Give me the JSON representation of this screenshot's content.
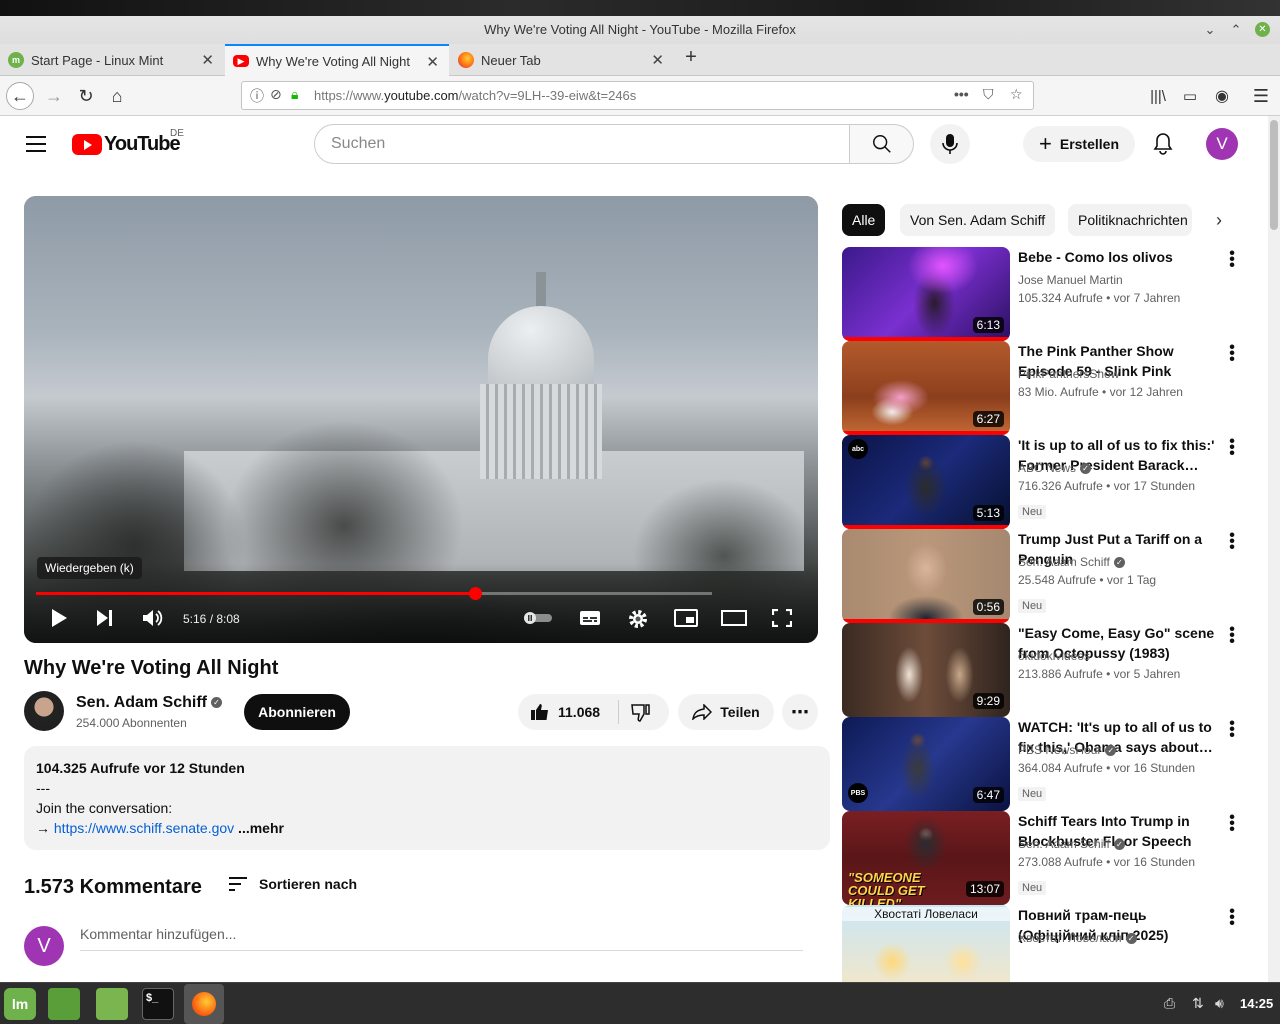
{
  "window": {
    "title": "Why We're Voting All Night - YouTube - Mozilla Firefox"
  },
  "tabs": [
    {
      "label": "Start Page - Linux Mint",
      "active": false
    },
    {
      "label": "Why We're Voting All Night",
      "active": true
    },
    {
      "label": "Neuer Tab",
      "active": false
    }
  ],
  "url": {
    "prefix": "https://www.",
    "domain": "youtube.com",
    "path": "/watch?v=9LH--39-eiw&t=246s"
  },
  "yt": {
    "logo": "YouTube",
    "country": "DE",
    "search_placeholder": "Suchen",
    "create_label": "Erstellen",
    "avatar_letter": "V"
  },
  "player": {
    "tooltip": "Wiedergeben (k)",
    "time": "5:16 / 8:08",
    "progress": 0.65
  },
  "video": {
    "title": "Why We're Voting All Night",
    "channel": "Sen. Adam Schiff",
    "subscribers": "254.000 Abonnenten",
    "subscribe_label": "Abonnieren",
    "likes": "11.068",
    "share_label": "Teilen",
    "description": {
      "stats": "104.325 Aufrufe  vor 12 Stunden",
      "line1": "---",
      "line2": "Join the conversation:",
      "arrow": "→ ",
      "link": "https://www.schiff.senate.gov",
      "more": " ...mehr"
    }
  },
  "comments": {
    "count": "1.573 Kommentare",
    "sort_label": "Sortieren nach",
    "avatar_letter": "V",
    "placeholder": "Kommentar hinzufügen..."
  },
  "chips": [
    "Alle",
    "Von Sen. Adam Schiff",
    "Politiknachrichten"
  ],
  "recommendations": [
    {
      "title": "Bebe - Como los olivos",
      "channel": "Jose Manuel Martin",
      "verified": false,
      "meta": "105.324 Aufrufe • vor 7 Jahren",
      "duration": "6:13",
      "new": "",
      "progress": 1,
      "thumb": "concert"
    },
    {
      "title": "The Pink Panther Show Episode 59 - Slink Pink",
      "channel": "PinkPanthersShow",
      "verified": false,
      "meta": "83 Mio. Aufrufe • vor 12 Jahren",
      "duration": "6:27",
      "new": "",
      "progress": 1,
      "thumb": "cartoon"
    },
    {
      "title": "'It is up to all of us to fix this:' Former President Barack…",
      "channel": "ABC News",
      "verified": true,
      "meta": "716.326 Aufrufe • vor 17 Stunden",
      "duration": "5:13",
      "new": "Neu",
      "progress": 1,
      "thumb": "stage"
    },
    {
      "title": "Trump Just Put a Tariff on a Penguin",
      "channel": "Sen. Adam Schiff",
      "verified": true,
      "meta": "25.548 Aufrufe • vor 1 Tag",
      "duration": "0:56",
      "new": "Neu",
      "progress": 1,
      "thumb": "portrait"
    },
    {
      "title": "\"Easy Come, Easy Go\" scene from Octopussy (1983)",
      "channel": "okidokivideos",
      "verified": false,
      "meta": "213.886 Aufrufe • vor 5 Jahren",
      "duration": "9:29",
      "new": "",
      "progress": 0,
      "thumb": "movie"
    },
    {
      "title": "WATCH: 'It's up to all of us to fix this,' Obama says about…",
      "channel": "PBS NewsHour",
      "verified": true,
      "meta": "364.084 Aufrufe • vor 16 Stunden",
      "duration": "6:47",
      "new": "Neu",
      "progress": 0,
      "thumb": "stage2"
    },
    {
      "title": "Schiff Tears Into Trump in Blockbuster Floor Speech",
      "channel": "Sen. Adam Schiff",
      "verified": true,
      "meta": "273.088 Aufrufe • vor 16 Stunden",
      "duration": "13:07",
      "new": "Neu",
      "progress": 0,
      "thumb": "senate",
      "caption": "\"SOMEONE COULD GET KILLED\""
    },
    {
      "title": "Повний трам-пець (Офіційний кліп 2025) Хвостаті Ловеласи",
      "channel": "Хвостаті Ловеласи",
      "verified": true,
      "meta": "",
      "duration": "",
      "new": "",
      "progress": 0,
      "thumb": "cartoon2",
      "caption": "Хвостаті Ловеласи"
    }
  ],
  "taskbar": {
    "clock": "14:25"
  }
}
